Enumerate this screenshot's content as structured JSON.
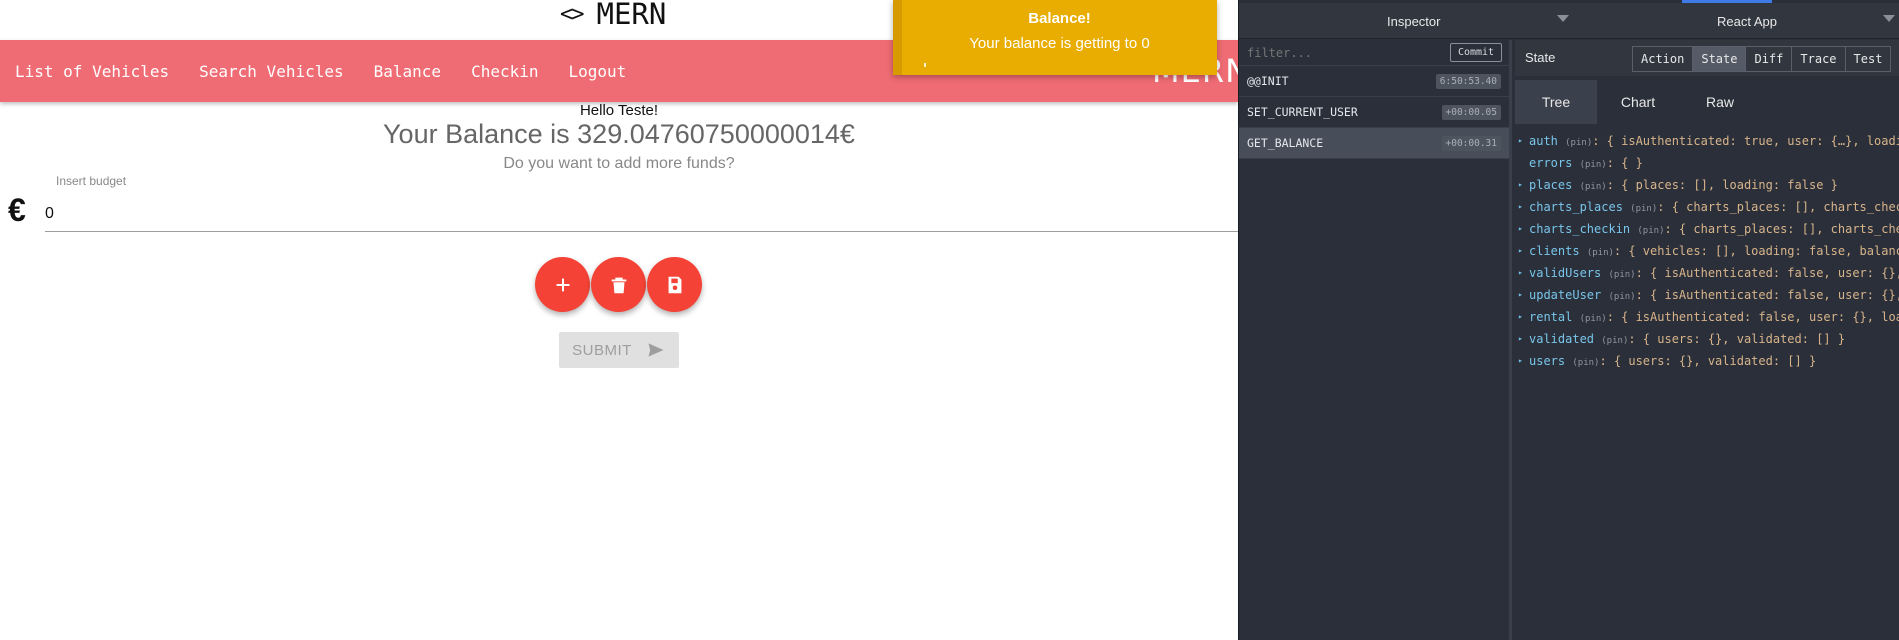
{
  "app": {
    "logo_glyph": "<>",
    "logo_text": "MERN",
    "brand": "MERN",
    "nav": [
      {
        "label": "List of Vehicles"
      },
      {
        "label": "Search Vehicles"
      },
      {
        "label": "Balance"
      },
      {
        "label": "Checkin"
      },
      {
        "label": "Logout"
      }
    ],
    "hello": "Hello Teste!",
    "balance_text": "Your Balance is 329.04760750000014€",
    "subtitle": "Do you want to add more funds?",
    "budget_label": "Insert budget",
    "budget_value": "0",
    "currency_icon": "€",
    "fab_icons": [
      "plus-icon",
      "trash-icon",
      "save-icon"
    ],
    "submit_label": "SUBMIT",
    "accent_color": "#ef6c74",
    "fab_color": "#f44336"
  },
  "toast": {
    "title": "Balance!",
    "message": "Your balance is getting to 0",
    "color": "#e8ad00"
  },
  "devtools": {
    "inspector_label": "Inspector",
    "app_label": "React App",
    "filter_placeholder": "filter...",
    "commit_label": "Commit",
    "actions": [
      {
        "name": "@@INIT",
        "time": "6:50:53.40"
      },
      {
        "name": "SET_CURRENT_USER",
        "time": "+00:00.05"
      },
      {
        "name": "GET_BALANCE",
        "time": "+00:00.31"
      }
    ],
    "state_title": "State",
    "tabs": [
      "Action",
      "State",
      "Diff",
      "Trace",
      "Test"
    ],
    "subtabs": [
      "Tree",
      "Chart",
      "Raw"
    ],
    "tree": [
      {
        "key": "auth",
        "pin": "(pin)",
        "value": ": { isAuthenticated: true, user: {…}, loading",
        "arrow": true
      },
      {
        "key": "errors",
        "pin": "(pin)",
        "value": ": { }",
        "arrow": false
      },
      {
        "key": "places",
        "pin": "(pin)",
        "value": ": { places: [], loading: false }",
        "arrow": true
      },
      {
        "key": "charts_places",
        "pin": "(pin)",
        "value": ": { charts_places: [], charts_check",
        "arrow": true
      },
      {
        "key": "charts_checkin",
        "pin": "(pin)",
        "value": ": { charts_places: [], charts_chec",
        "arrow": true
      },
      {
        "key": "clients",
        "pin": "(pin)",
        "value": ": { vehicles: [], loading: false, balance",
        "arrow": true
      },
      {
        "key": "validUsers",
        "pin": "(pin)",
        "value": ": { isAuthenticated: false, user: {},",
        "arrow": true
      },
      {
        "key": "updateUser",
        "pin": "(pin)",
        "value": ": { isAuthenticated: false, user: {},",
        "arrow": true
      },
      {
        "key": "rental",
        "pin": "(pin)",
        "value": ": { isAuthenticated: false, user: {}, load",
        "arrow": true
      },
      {
        "key": "validated",
        "pin": "(pin)",
        "value": ": { users: {}, validated: [] }",
        "arrow": true
      },
      {
        "key": "users",
        "pin": "(pin)",
        "value": ": { users: {}, validated: [] }",
        "arrow": true
      }
    ]
  }
}
